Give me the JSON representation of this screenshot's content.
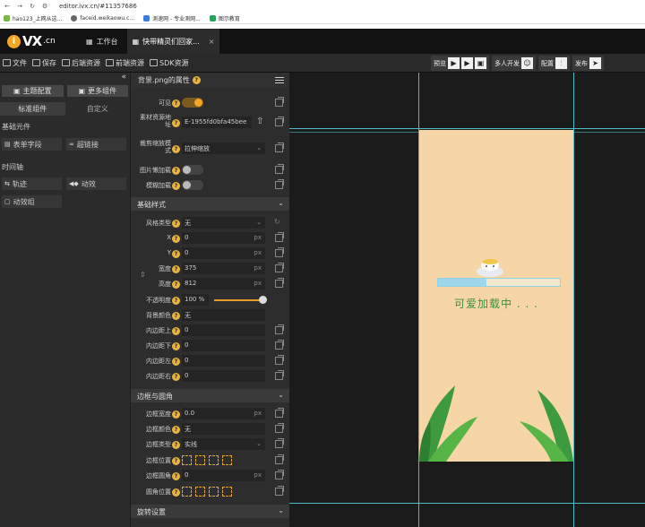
{
  "browser": {
    "url": "editor.ivx.cn/#11357686",
    "bookmarks": [
      "hao123_上网从这...",
      "faceid.weikaowu.c...",
      "测速网 - 专业测网...",
      "图示教育"
    ]
  },
  "app": {
    "logo_i": "i",
    "logo_vx": "VX",
    "logo_cn": ".cn",
    "tab_workbench": "工作台",
    "tab_project": "快带精灵们回家...",
    "tab_close": "×"
  },
  "toolbar": {
    "file": "文件",
    "save": "保存",
    "backend": "后端资源",
    "frontend": "前端资源",
    "sdk": "SDK资源",
    "preview": "预览",
    "collab": "多人开发",
    "config": "配置",
    "publish": "发布"
  },
  "left": {
    "collapse": "«",
    "theme_btn": "主题配置",
    "more_btn": "更多组件",
    "tab_std": "标准组件",
    "tab_custom": "自定义",
    "sec_basic": "基础元件",
    "form_field": "表单字段",
    "hyperlink": "超链接",
    "sec_timeline": "时间轴",
    "track": "轨迹",
    "anim": "动效",
    "anim_group": "动效组"
  },
  "props": {
    "title": "背景.png的属性",
    "visible": "可见",
    "visible_on": true,
    "src_label": "素材资源地址",
    "src_value": "E-1955fd0bfa45bee",
    "scale_label": "裁剪缩放模式",
    "scale_value": "拉伸缩放",
    "lazy_label": "图片懒加载",
    "blur_label": "模糊加载",
    "sec_base": "基础样式",
    "style_type": "风格类型",
    "style_value": "无",
    "x_label": "X",
    "x_value": "0",
    "y_label": "Y",
    "y_value": "0",
    "w_label": "宽度",
    "w_value": "375",
    "h_label": "高度",
    "h_value": "812",
    "opacity_label": "不透明度",
    "opacity_value": "100 %",
    "opacity": 1.0,
    "bg_label": "背景颜色",
    "bg_value": "无",
    "pt_label": "内边距上",
    "pt_value": "0",
    "pb_label": "内边距下",
    "pb_value": "0",
    "pl_label": "内边距左",
    "pl_value": "0",
    "pr_label": "内边距右",
    "pr_value": "0",
    "sec_border": "边框与圆角",
    "bw_label": "边框宽度",
    "bw_value": "0.0",
    "bc_label": "边框颜色",
    "bc_value": "无",
    "bt_label": "边框类型",
    "bt_value": "实线",
    "bpos_label": "边框位置",
    "br_label": "边框圆角",
    "br_value": "0",
    "rpos_label": "圆角位置",
    "sec_rotate": "旋转设置",
    "unit_px": "px"
  },
  "canvas": {
    "loading_text": "可爱加载中 . . .",
    "progress": 0.4
  }
}
